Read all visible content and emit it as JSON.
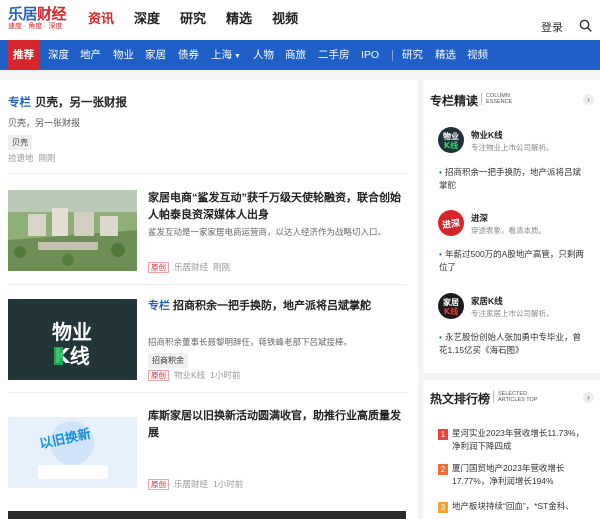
{
  "header": {
    "logo_a": "乐居",
    "logo_b": "财经",
    "logo_tagline": "速度 · 角度 · 深度",
    "nav": [
      "资讯",
      "深度",
      "研究",
      "精选",
      "视频"
    ],
    "login": "登录",
    "search_icon": "search-icon"
  },
  "catbar": {
    "items": [
      "推荐",
      "深度",
      "地产",
      "物业",
      "家居",
      "债券",
      "上海",
      "人物",
      "商旅",
      "二手房",
      "IPO",
      "研究",
      "精选",
      "视频"
    ],
    "dropdown_caret": "▼"
  },
  "special": {
    "tag": "专栏",
    "title": "贝壳，另一张财报",
    "desc": "贝壳，另一张财报",
    "chip": "贝壳",
    "source": "拾遗地",
    "time": "刚刚"
  },
  "articles": [
    {
      "title": "家居电商“鲨发互动”获千万级天使轮融资，联合创始人帕泰良资深媒体人出身",
      "desc": "鲨发互动是一家家居电商运营商，以达人经济作为战略切入口。",
      "badge": "原创",
      "source": "乐居财经",
      "time": "刚刚"
    },
    {
      "tag": "专栏",
      "title": "招商积余一把手换防，地产派将吕斌掌舵",
      "desc": "招商积余董事长聂黎明辞任，蒋铁峰老部下吕斌接棒。",
      "chip": "招商积余",
      "badge": "原创",
      "source": "物业K线",
      "time": "1小时前",
      "thumb_text_a": "物业",
      "thumb_text_b": "K线"
    },
    {
      "title": "库斯家居以旧换新活动圆满收官，助推行业高质量发展",
      "badge": "原创",
      "source": "乐居财经",
      "time": "1小时前",
      "thumb_text": "以旧换新"
    }
  ],
  "columns": {
    "title": "专栏精读",
    "title_en_1": "COLUMN",
    "title_en_2": "ESSENCE",
    "arrow": "›",
    "items": [
      {
        "name": "物业K线",
        "desc": "专注物业上市公司解析。",
        "article": "招商积余一把手换防，地产派将吕斌掌舵",
        "avatar_a": "物业",
        "avatar_b": "K线"
      },
      {
        "name": "进深",
        "desc": "穿透表象，看清本质。",
        "article": "年薪过500万的A股地产高管，只剩两位了",
        "avatar": "进深"
      },
      {
        "name": "家居K线",
        "desc": "专注家居上市公司解析。",
        "article": "永艺股份创始人张加勇中专毕业，曾花1.15亿买《海石图》",
        "avatar_a": "家居",
        "avatar_b": "K线"
      }
    ]
  },
  "hot": {
    "title": "热文排行榜",
    "title_en_1": "SELECTED",
    "title_en_2": "ARTICLES TOP",
    "arrow": "›",
    "items": [
      {
        "rank": "1",
        "text": "星河实业2023年营收增长11.73%，净利润下降四成"
      },
      {
        "rank": "2",
        "text": "厦门国贸地产2023年营收增长17.77%，净利润增长194%"
      },
      {
        "rank": "3",
        "text": "地产板块持续“回血”，*ST金科、"
      }
    ]
  },
  "colors": {
    "brand_blue": "#1f5fc7",
    "brand_red": "#d6262c",
    "page_bg": "#f4f4f4"
  }
}
